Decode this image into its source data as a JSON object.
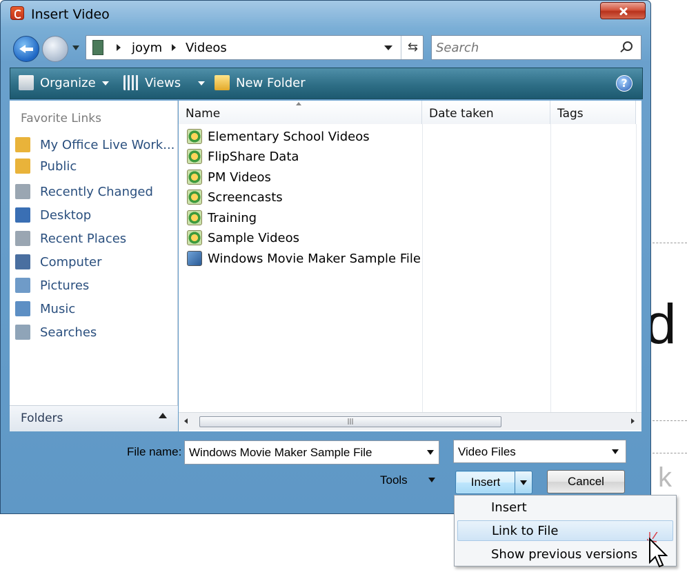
{
  "window": {
    "title": "Insert Video",
    "app_icon": "office-icon",
    "close_icon": "close-icon"
  },
  "address": {
    "segments": [
      "joym",
      "Videos"
    ],
    "search_placeholder": "Search"
  },
  "toolbar": {
    "organize": "Organize",
    "views": "Views",
    "new_folder": "New Folder"
  },
  "nav": {
    "favorites_label": "Favorite Links",
    "items": [
      {
        "label": "My Office Live Work...",
        "icon": "folder-icon",
        "color": "#e9b33a"
      },
      {
        "label": "Public",
        "icon": "folder-icon",
        "color": "#e9b33a"
      },
      {
        "label": "Recently Changed",
        "icon": "recent-icon",
        "color": "#9aa6b2"
      },
      {
        "label": "Desktop",
        "icon": "desktop-icon",
        "color": "#3a6fb4"
      },
      {
        "label": "Recent Places",
        "icon": "places-icon",
        "color": "#9aa6b2"
      },
      {
        "label": "Computer",
        "icon": "computer-icon",
        "color": "#4a6fa0"
      },
      {
        "label": "Pictures",
        "icon": "pictures-icon",
        "color": "#6f9bc8"
      },
      {
        "label": "Music",
        "icon": "music-icon",
        "color": "#5d8fc4"
      },
      {
        "label": "Searches",
        "icon": "searches-icon",
        "color": "#8fa4b8"
      }
    ],
    "folders_label": "Folders"
  },
  "columns": [
    "Name",
    "Date taken",
    "Tags"
  ],
  "files": [
    {
      "name": "Elementary School Videos",
      "type": "folder"
    },
    {
      "name": "FlipShare Data",
      "type": "folder"
    },
    {
      "name": "PM Videos",
      "type": "folder"
    },
    {
      "name": "Screencasts",
      "type": "folder"
    },
    {
      "name": "Training",
      "type": "folder"
    },
    {
      "name": "Sample Videos",
      "type": "folder"
    },
    {
      "name": "Windows Movie Maker Sample File",
      "type": "video"
    }
  ],
  "bottom": {
    "file_name_label": "File name:",
    "file_name_value": "Windows Movie Maker Sample File",
    "filter": "Video Files",
    "tools": "Tools",
    "insert": "Insert",
    "cancel": "Cancel"
  },
  "menu": [
    "Insert",
    "Link to File",
    "Show previous versions"
  ],
  "background_doc": {
    "letter": "d",
    "letter2": "k"
  }
}
